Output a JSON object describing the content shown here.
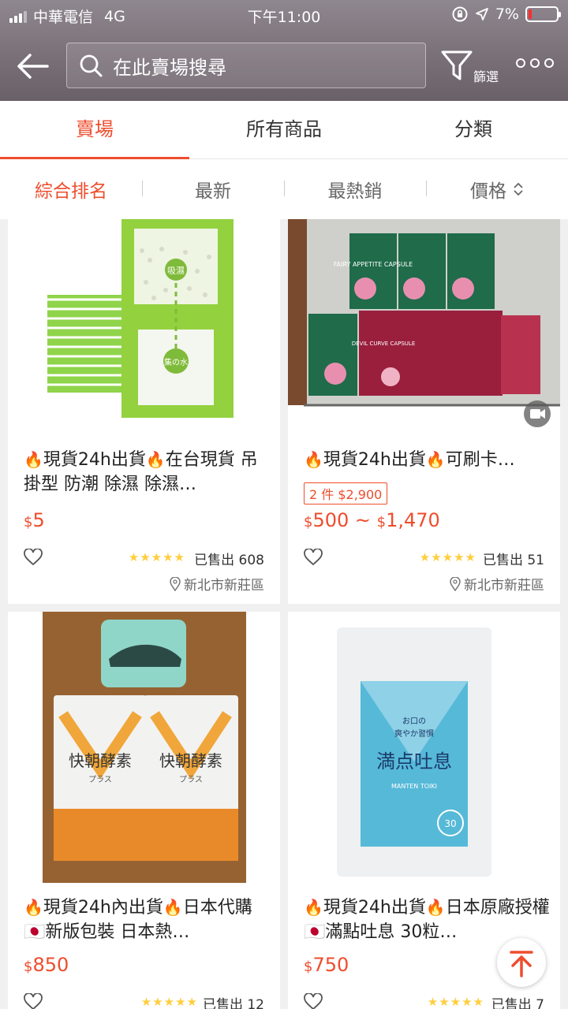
{
  "status_bar": {
    "carrier": "中華電信",
    "network": "4G",
    "time": "下午11:00",
    "battery": "7%"
  },
  "header": {
    "search_placeholder": "在此賣場搜尋",
    "filter_label": "篩選"
  },
  "tabs": [
    {
      "label": "賣場",
      "active": true
    },
    {
      "label": "所有商品",
      "active": false
    },
    {
      "label": "分類",
      "active": false
    }
  ],
  "sort": [
    {
      "label": "綜合排名",
      "active": true
    },
    {
      "label": "最新",
      "active": false
    },
    {
      "label": "最熱銷",
      "active": false
    },
    {
      "label": "價格",
      "active": false
    }
  ],
  "products": [
    {
      "title_a": "現貨24h出貨",
      "title_b": "在台現貨 吊掛型 防潮 除濕 除濕…",
      "badge": "",
      "price": "5",
      "price_max": "",
      "rating": 5,
      "sold": "已售出 608",
      "location": "新北市新莊區",
      "image_text": [
        "吸濕",
        "集の水"
      ]
    },
    {
      "title_a": "現貨24h出貨",
      "title_b": "可刷卡…",
      "badge": "2 件 $2,900",
      "price": "500",
      "price_max": "1,470",
      "rating": 5,
      "sold": "已售出 51",
      "location": "新北市新莊區",
      "image_text": [
        "FAIRY APPETITE CAPSULE",
        "DEVIL CURVE CAPSULE"
      ]
    },
    {
      "title_a": "現貨24h內出貨",
      "title_b": "日本代購🇯🇵新版包裝 日本熱…",
      "badge": "",
      "price": "850",
      "price_max": "",
      "rating": 5,
      "sold": "已售出 12",
      "location": "",
      "image_text": [
        "快朝酵素",
        "プラス"
      ]
    },
    {
      "title_a": "現貨24h出貨",
      "title_b": "日本原廠授權🇯🇵滿點吐息 30粒…",
      "badge": "",
      "price": "750",
      "price_max": "",
      "rating": 5,
      "sold": "已售出 7",
      "location": "",
      "image_text": [
        "満点吐息",
        "お口の",
        "爽やか習慣",
        "MANTEN TOIKI",
        "30"
      ]
    }
  ],
  "currency_symbol": "$",
  "fire_emoji": "🔥",
  "colors": {
    "accent": "#ee4d2d",
    "star": "#ffce3d"
  }
}
